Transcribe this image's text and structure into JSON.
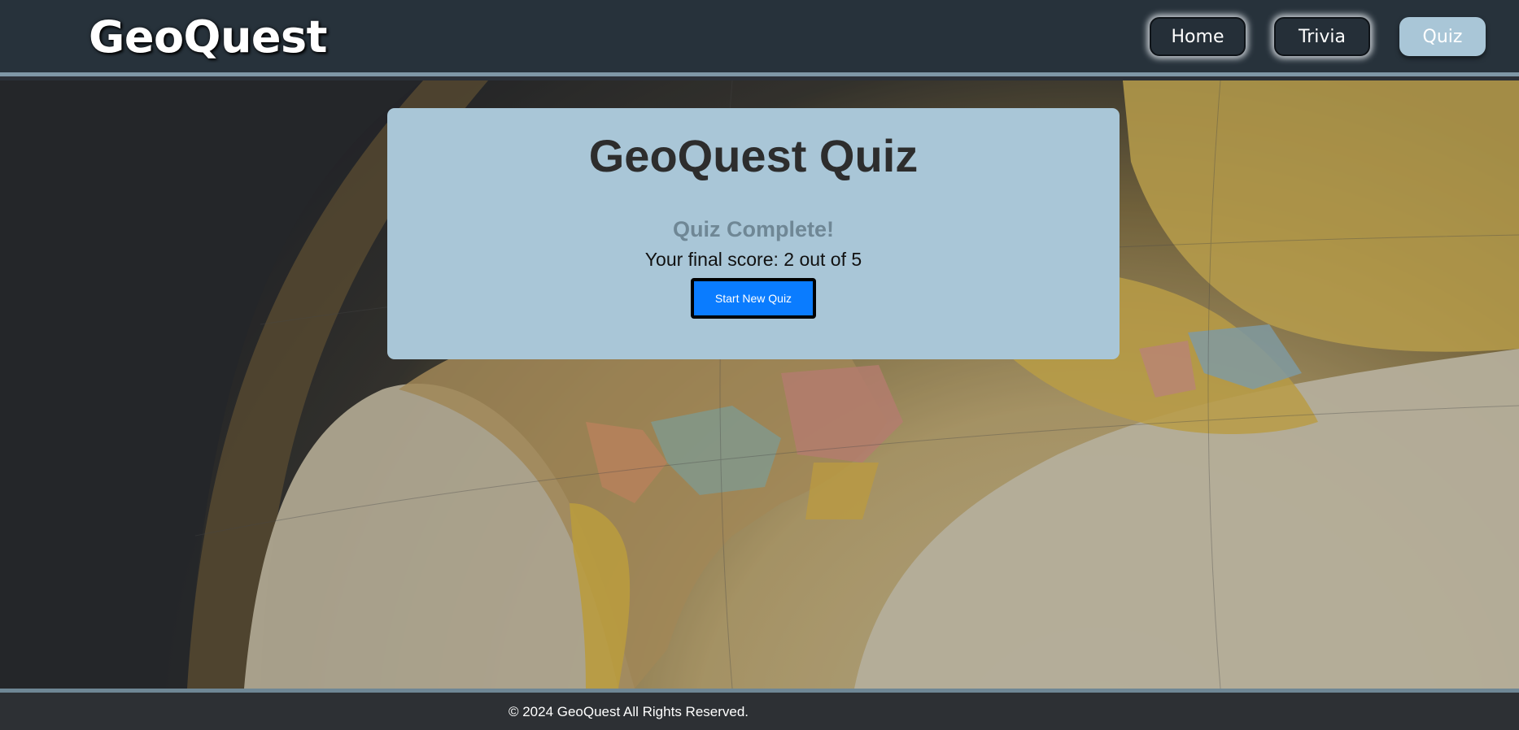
{
  "header": {
    "logo": "GeoQuest",
    "nav": [
      {
        "label": "Home"
      },
      {
        "label": "Trivia"
      },
      {
        "label": "Quiz"
      }
    ]
  },
  "quiz": {
    "title": "GeoQuest Quiz",
    "status": "Quiz Complete!",
    "score_text": "Your final score: 2 out of 5",
    "score": 2,
    "total": 5,
    "start_button": "Start New Quiz"
  },
  "footer": {
    "text": "© 2024 GeoQuest All Rights Reserved."
  },
  "colors": {
    "header_bg": "#27323b",
    "card_bg": "#a9c6d7",
    "button_blue": "#0a7cff",
    "footer_bg": "#2d3034"
  }
}
